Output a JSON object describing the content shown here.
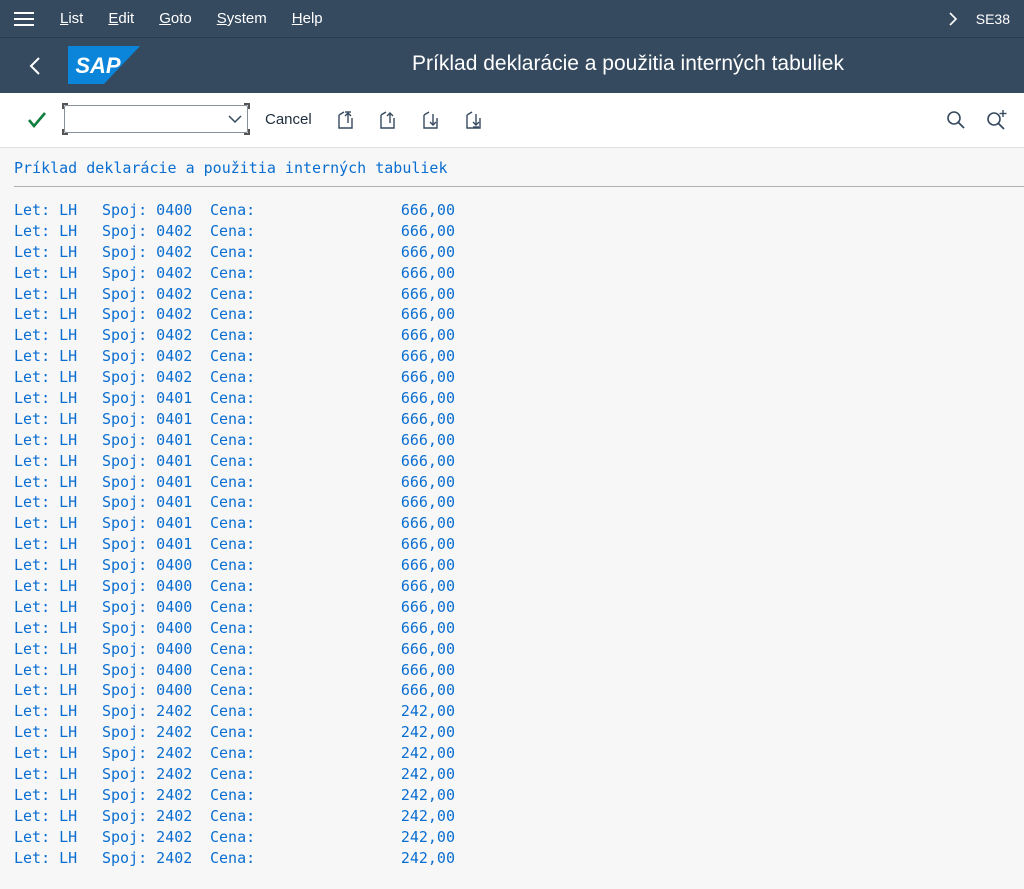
{
  "menubar": {
    "items": [
      {
        "acc": "L",
        "rest": "ist"
      },
      {
        "acc": "E",
        "rest": "dit"
      },
      {
        "acc": "G",
        "rest": "oto"
      },
      {
        "acc": "S",
        "rest": "ystem"
      },
      {
        "acc": "H",
        "rest": "elp"
      }
    ],
    "tcode": "SE38"
  },
  "titlebar": {
    "logo_text": "SAP",
    "title": "Príklad deklarácie a použitia interných tabuliek"
  },
  "toolbar": {
    "command_value": "",
    "cancel_label": "Cancel"
  },
  "colors": {
    "shell": "#354a5f",
    "accent": "#0a6ed1",
    "check": "#107e3e",
    "logo": "#0a85d9"
  },
  "icons": {
    "menu": "hamburger-icon",
    "expand": "chevron-right-icon",
    "back": "chevron-left-icon",
    "enter": "checkmark-icon",
    "first_page": "first-page-icon",
    "previous_page": "previous-page-icon",
    "next_page": "next-page-icon",
    "last_page": "last-page-icon",
    "find": "search-icon",
    "find_next": "search-next-icon"
  },
  "list": {
    "header": "Príklad deklarácie a použitia interných tabuliek",
    "rows": [
      {
        "let": "Let: LH",
        "spoj": "Spoj: 0400",
        "cena": "Cena:",
        "price": "666,00"
      },
      {
        "let": "Let: LH",
        "spoj": "Spoj: 0402",
        "cena": "Cena:",
        "price": "666,00"
      },
      {
        "let": "Let: LH",
        "spoj": "Spoj: 0402",
        "cena": "Cena:",
        "price": "666,00"
      },
      {
        "let": "Let: LH",
        "spoj": "Spoj: 0402",
        "cena": "Cena:",
        "price": "666,00"
      },
      {
        "let": "Let: LH",
        "spoj": "Spoj: 0402",
        "cena": "Cena:",
        "price": "666,00"
      },
      {
        "let": "Let: LH",
        "spoj": "Spoj: 0402",
        "cena": "Cena:",
        "price": "666,00"
      },
      {
        "let": "Let: LH",
        "spoj": "Spoj: 0402",
        "cena": "Cena:",
        "price": "666,00"
      },
      {
        "let": "Let: LH",
        "spoj": "Spoj: 0402",
        "cena": "Cena:",
        "price": "666,00"
      },
      {
        "let": "Let: LH",
        "spoj": "Spoj: 0402",
        "cena": "Cena:",
        "price": "666,00"
      },
      {
        "let": "Let: LH",
        "spoj": "Spoj: 0401",
        "cena": "Cena:",
        "price": "666,00"
      },
      {
        "let": "Let: LH",
        "spoj": "Spoj: 0401",
        "cena": "Cena:",
        "price": "666,00"
      },
      {
        "let": "Let: LH",
        "spoj": "Spoj: 0401",
        "cena": "Cena:",
        "price": "666,00"
      },
      {
        "let": "Let: LH",
        "spoj": "Spoj: 0401",
        "cena": "Cena:",
        "price": "666,00"
      },
      {
        "let": "Let: LH",
        "spoj": "Spoj: 0401",
        "cena": "Cena:",
        "price": "666,00"
      },
      {
        "let": "Let: LH",
        "spoj": "Spoj: 0401",
        "cena": "Cena:",
        "price": "666,00"
      },
      {
        "let": "Let: LH",
        "spoj": "Spoj: 0401",
        "cena": "Cena:",
        "price": "666,00"
      },
      {
        "let": "Let: LH",
        "spoj": "Spoj: 0401",
        "cena": "Cena:",
        "price": "666,00"
      },
      {
        "let": "Let: LH",
        "spoj": "Spoj: 0400",
        "cena": "Cena:",
        "price": "666,00"
      },
      {
        "let": "Let: LH",
        "spoj": "Spoj: 0400",
        "cena": "Cena:",
        "price": "666,00"
      },
      {
        "let": "Let: LH",
        "spoj": "Spoj: 0400",
        "cena": "Cena:",
        "price": "666,00"
      },
      {
        "let": "Let: LH",
        "spoj": "Spoj: 0400",
        "cena": "Cena:",
        "price": "666,00"
      },
      {
        "let": "Let: LH",
        "spoj": "Spoj: 0400",
        "cena": "Cena:",
        "price": "666,00"
      },
      {
        "let": "Let: LH",
        "spoj": "Spoj: 0400",
        "cena": "Cena:",
        "price": "666,00"
      },
      {
        "let": "Let: LH",
        "spoj": "Spoj: 0400",
        "cena": "Cena:",
        "price": "666,00"
      },
      {
        "let": "Let: LH",
        "spoj": "Spoj: 2402",
        "cena": "Cena:",
        "price": "242,00"
      },
      {
        "let": "Let: LH",
        "spoj": "Spoj: 2402",
        "cena": "Cena:",
        "price": "242,00"
      },
      {
        "let": "Let: LH",
        "spoj": "Spoj: 2402",
        "cena": "Cena:",
        "price": "242,00"
      },
      {
        "let": "Let: LH",
        "spoj": "Spoj: 2402",
        "cena": "Cena:",
        "price": "242,00"
      },
      {
        "let": "Let: LH",
        "spoj": "Spoj: 2402",
        "cena": "Cena:",
        "price": "242,00"
      },
      {
        "let": "Let: LH",
        "spoj": "Spoj: 2402",
        "cena": "Cena:",
        "price": "242,00"
      },
      {
        "let": "Let: LH",
        "spoj": "Spoj: 2402",
        "cena": "Cena:",
        "price": "242,00"
      },
      {
        "let": "Let: LH",
        "spoj": "Spoj: 2402",
        "cena": "Cena:",
        "price": "242,00"
      }
    ]
  }
}
